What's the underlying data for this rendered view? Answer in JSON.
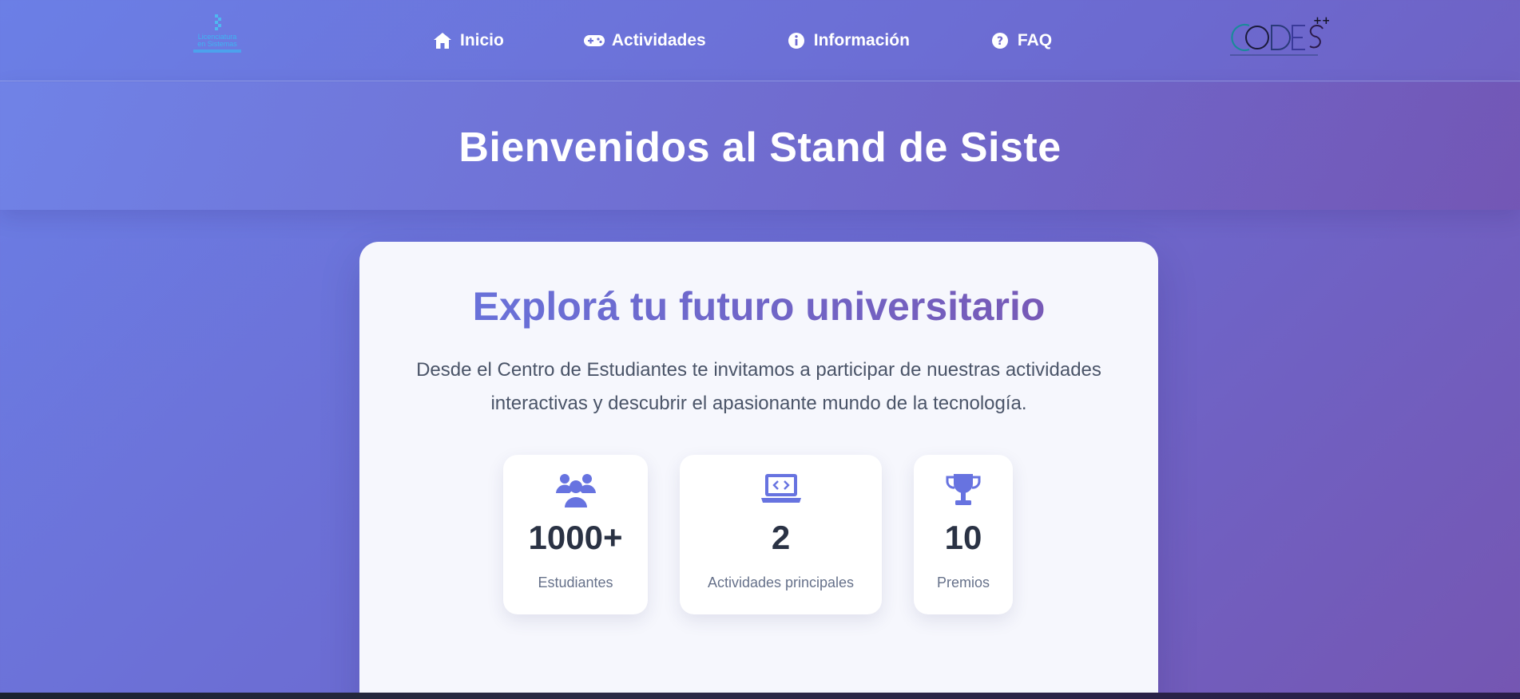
{
  "header": {
    "logo_left": {
      "line1": "Licenciatura",
      "line2": "en Sistemas",
      "icon": "university-logo"
    },
    "nav": [
      {
        "label": "Inicio",
        "icon": "home-icon"
      },
      {
        "label": "Actividades",
        "icon": "gamepad-icon"
      },
      {
        "label": "Información",
        "icon": "info-circle-icon"
      },
      {
        "label": "FAQ",
        "icon": "question-circle-icon"
      }
    ],
    "logo_right": {
      "icon": "codes-logo"
    }
  },
  "hero": {
    "title": "Bienvenidos al Stand de Siste"
  },
  "main": {
    "heading": "Explorá tu futuro universitario",
    "description": "Desde el Centro de Estudiantes te invitamos a participar de nuestras actividades interactivas y descubrir el apasionante mundo de la tecnología.",
    "stats": [
      {
        "value": "1000+",
        "label": "Estudiantes",
        "icon": "users-icon"
      },
      {
        "value": "2",
        "label": "Actividades principales",
        "icon": "laptop-code-icon"
      },
      {
        "value": "10",
        "label": "Premios",
        "icon": "trophy-icon"
      }
    ]
  },
  "colors": {
    "accent": "#6676e0",
    "accent_end": "#7a55b0",
    "text_dark": "#2a3244",
    "text_muted": "#66718a"
  }
}
